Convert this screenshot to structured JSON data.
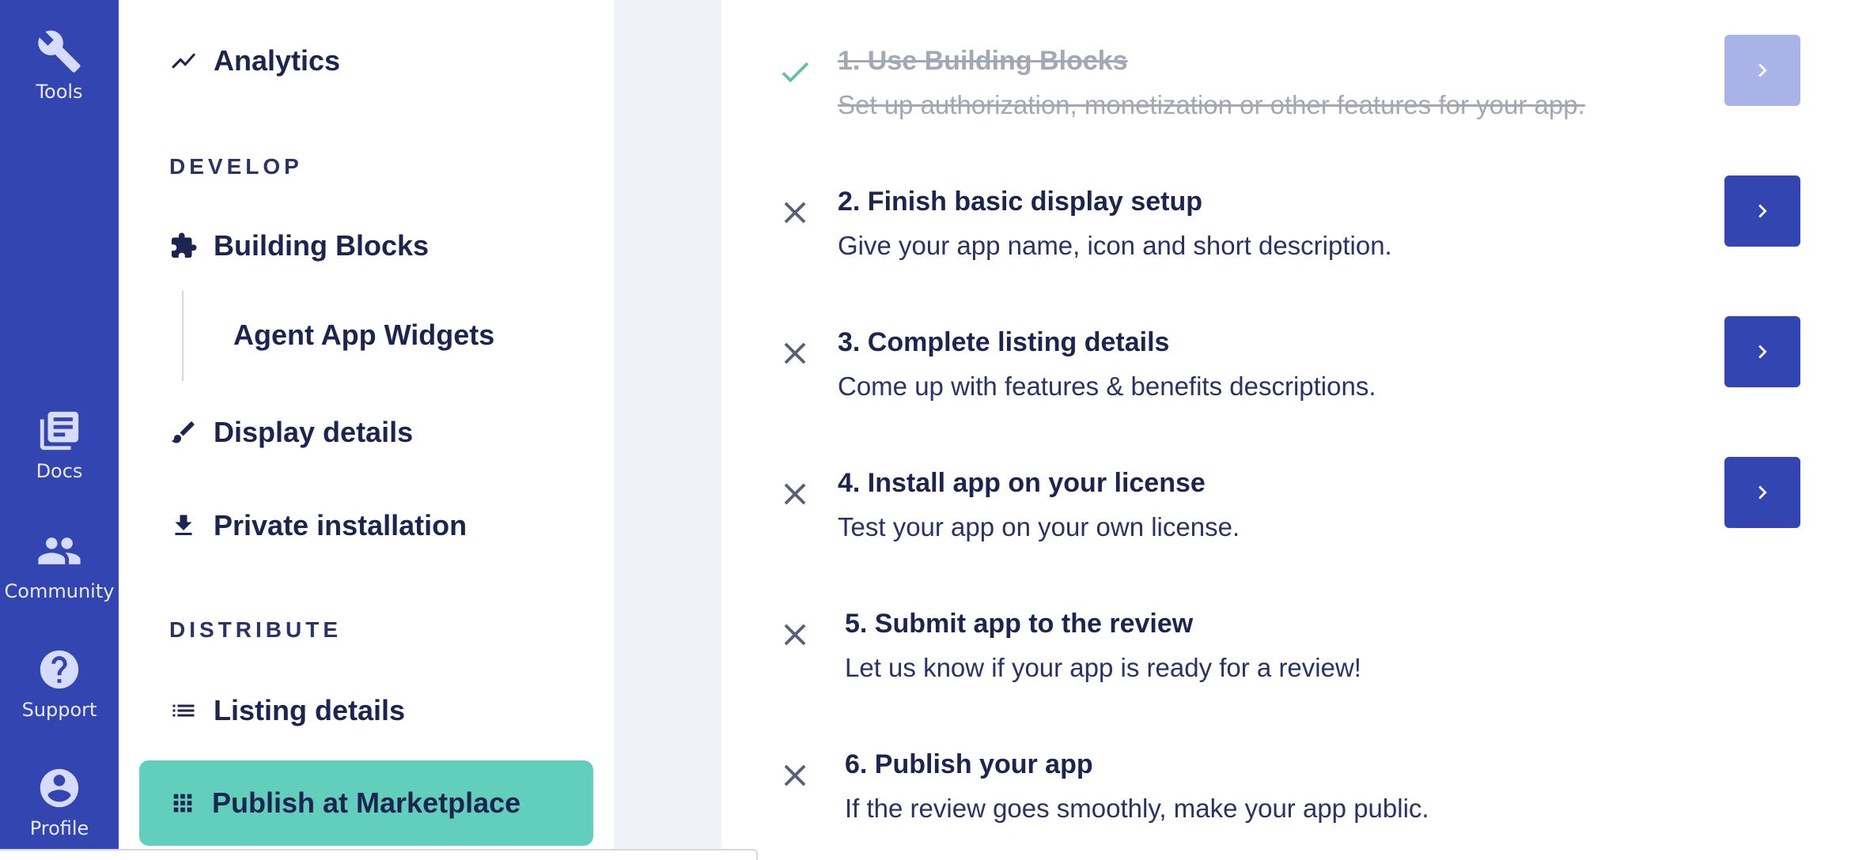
{
  "rail": {
    "items": [
      {
        "label": "Tools",
        "icon": "wrench-icon"
      },
      {
        "label": "Docs",
        "icon": "docs-icon"
      },
      {
        "label": "Community",
        "icon": "community-icon"
      },
      {
        "label": "Support",
        "icon": "help-icon"
      },
      {
        "label": "Profile",
        "icon": "profile-icon"
      }
    ]
  },
  "sidebar": {
    "analytics": "Analytics",
    "develop_label": "DEVELOP",
    "building_blocks": "Building Blocks",
    "agent_app_widgets": "Agent App Widgets",
    "display_details": "Display details",
    "private_installation": "Private installation",
    "distribute_label": "DISTRIBUTE",
    "listing_details": "Listing details",
    "publish": "Publish at Marketplace"
  },
  "steps": [
    {
      "title": "1. Use Building Blocks",
      "desc": "Set up authorization, monetization or other features for your app.",
      "status": "done"
    },
    {
      "title": "2. Finish basic display setup",
      "desc": "Give your app name, icon and short description.",
      "status": "todo"
    },
    {
      "title": "3. Complete listing details",
      "desc": "Come up with features & benefits descriptions.",
      "status": "todo"
    },
    {
      "title": "4. Install app on your license",
      "desc": "Test your app on your own license.",
      "status": "todo"
    },
    {
      "title": "5. Submit app to the review",
      "desc": "Let us know if your app is ready for a review!",
      "status": "todo"
    },
    {
      "title": "6. Publish your app",
      "desc": "If the review goes smoothly, make your app public.",
      "status": "todo"
    }
  ],
  "colors": {
    "rail": "#3345b0",
    "active_item": "#62cfbd",
    "check": "#5fc4a3",
    "cross": "#5a5f78",
    "button": "#3345b0",
    "button_disabled": "#aab3e8"
  }
}
